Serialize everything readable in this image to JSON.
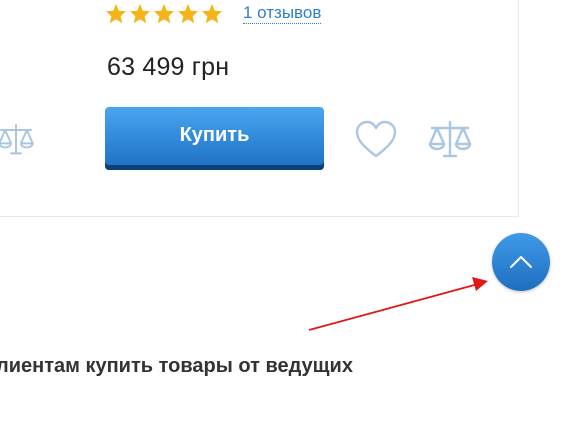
{
  "product": {
    "rating": 5,
    "reviews_label": "1 отзывов",
    "price": "63 499 грн",
    "buy_label": "Купить"
  },
  "icons": {
    "wishlist": "heart-icon",
    "compare": "scales-icon",
    "scroll_top": "chevron-up-icon",
    "annotation": "red-arrow"
  },
  "seo": {
    "text": "лиентам купить товары от ведущих"
  },
  "colors": {
    "star": "#f5b31a",
    "link": "#2f80c9",
    "button_top": "#4ba6ee",
    "button_bottom": "#1f6ec0",
    "button_shadow": "#0d3f7a",
    "icon_outline": "#a9c7e3",
    "annotation": "#e01818"
  }
}
